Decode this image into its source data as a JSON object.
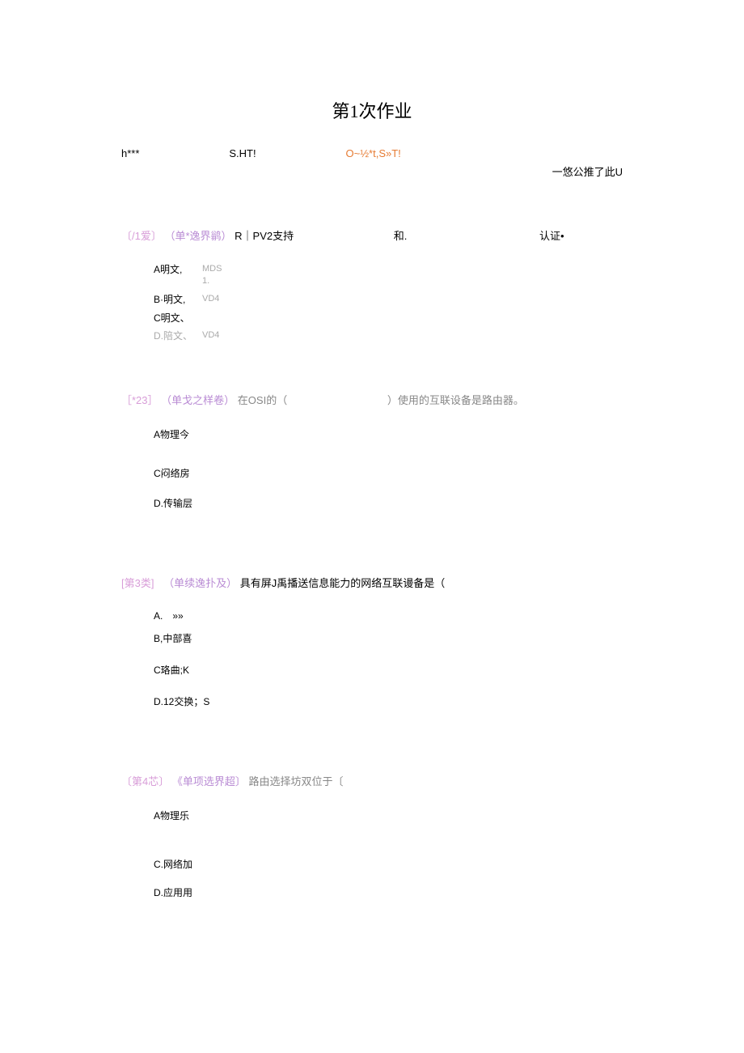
{
  "title": "第1次作业",
  "header": {
    "left": "h***",
    "mid": "S.HT!",
    "orange": "O~½*t,S»T!",
    "right": "一悠公推了此U"
  },
  "q1": {
    "tag": "〔/1爱〕",
    "label": "（单*逸界鹟）",
    "text_a": "R｜PV2支持",
    "text_b": "和.",
    "text_c": "认证•",
    "options": {
      "a_left": "A明文,",
      "a_right_line1": "MDS",
      "a_right_line2": "1.",
      "b_left": "B·明文,",
      "b_right": "VD4",
      "c_left": "C明文、",
      "d_left": "D.陪文、",
      "d_right": "VD4"
    }
  },
  "q2": {
    "tag": "［*23］",
    "label": "（单戈之样卷）",
    "text_a": "在OSI的（",
    "text_b": "）使用的互联设备是路由器。",
    "options": {
      "a": "A物理今",
      "c": "C闷络房",
      "d": "D.传输层"
    }
  },
  "q3": {
    "tag": "[第3类]",
    "label": "（单续逸扑及）",
    "text": "具有屏J禹播送信息能力的网络互联谩备是（",
    "options": {
      "a": "A. »»",
      "b": "B,中部喜",
      "c": "C珞曲;K",
      "d": "D.12交换；S"
    }
  },
  "q4": {
    "tag": "〔第4芯〕",
    "label": "《单项选界超〕",
    "text": "路由选择坊双位于〔",
    "options": {
      "a": "A物理乐",
      "c": "C.网络加",
      "d": "D.应用用"
    }
  }
}
